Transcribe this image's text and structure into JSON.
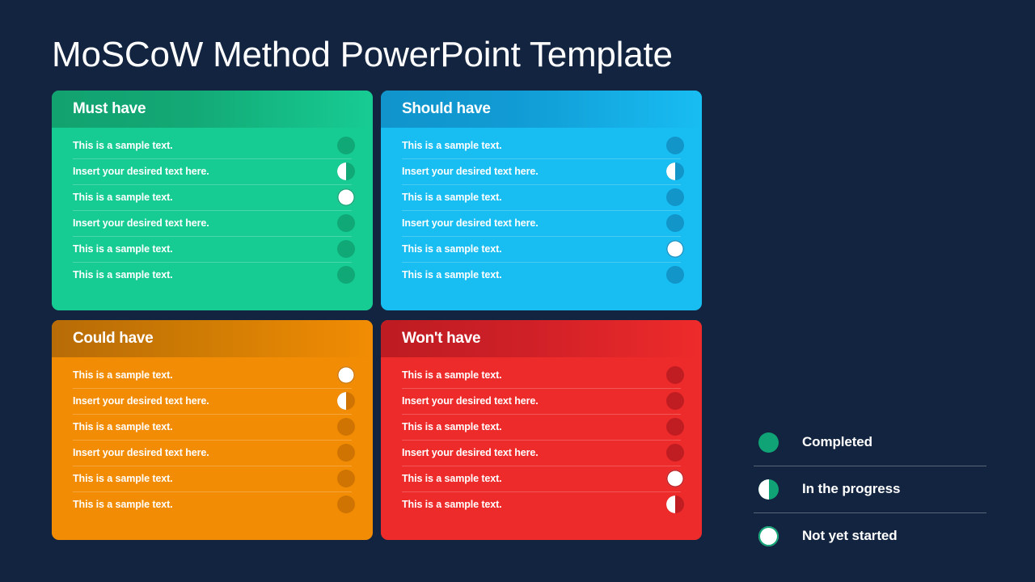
{
  "slide": {
    "title": "MoSCoW Method PowerPoint Template",
    "background_color": "#12243f"
  },
  "cards": [
    {
      "id": "must-have",
      "title": "Must have",
      "body_color": "#17cc93",
      "header_color": "#12a270",
      "dot_color": "#10a877",
      "rows": [
        {
          "text": "This is a sample text.",
          "status": "completed"
        },
        {
          "text": "Insert your desired text here.",
          "status": "inprogress"
        },
        {
          "text": "This is a sample text.",
          "status": "notstarted"
        },
        {
          "text": "Insert your desired text here.",
          "status": "completed"
        },
        {
          "text": "This is a sample text.",
          "status": "completed"
        },
        {
          "text": "This is a sample text.",
          "status": "completed"
        }
      ]
    },
    {
      "id": "should-have",
      "title": "Should have",
      "body_color": "#18bdf2",
      "header_color": "#1194cc",
      "dot_color": "#1295c9",
      "rows": [
        {
          "text": "This is a sample text.",
          "status": "completed"
        },
        {
          "text": "Insert your desired text here.",
          "status": "inprogress"
        },
        {
          "text": "This is a sample text.",
          "status": "completed"
        },
        {
          "text": "Insert your desired text here.",
          "status": "completed"
        },
        {
          "text": "This is a sample text.",
          "status": "notstarted"
        },
        {
          "text": "This is a sample text.",
          "status": "completed"
        }
      ]
    },
    {
      "id": "could-have",
      "title": "Could have",
      "body_color": "#f28c04",
      "header_color": "#ce7b04",
      "dot_color": "#cf7402",
      "rows": [
        {
          "text": "This is a sample text.",
          "status": "notstarted"
        },
        {
          "text": "Insert your desired text here.",
          "status": "inprogress"
        },
        {
          "text": "This is a sample text.",
          "status": "completed"
        },
        {
          "text": "Insert your desired text here.",
          "status": "completed"
        },
        {
          "text": "This is a sample text.",
          "status": "completed"
        },
        {
          "text": "This is a sample text.",
          "status": "completed"
        }
      ]
    },
    {
      "id": "wont-have",
      "title": "Won't have",
      "body_color": "#ee2b2b",
      "header_color": "#cf2027",
      "dot_color": "#bf1d21",
      "rows": [
        {
          "text": "This is a sample text.",
          "status": "completed"
        },
        {
          "text": "Insert your desired text here.",
          "status": "completed"
        },
        {
          "text": "This is a sample text.",
          "status": "completed"
        },
        {
          "text": "Insert your desired text here.",
          "status": "completed"
        },
        {
          "text": "This is a sample text.",
          "status": "notstarted"
        },
        {
          "text": "This is a sample text.",
          "status": "inprogress"
        }
      ]
    }
  ],
  "legend": {
    "accent_color": "#0fa375",
    "items": [
      {
        "label": "Completed",
        "status": "completed"
      },
      {
        "label": "In the progress",
        "status": "inprogress"
      },
      {
        "label": "Not yet started",
        "status": "notstarted"
      }
    ]
  }
}
